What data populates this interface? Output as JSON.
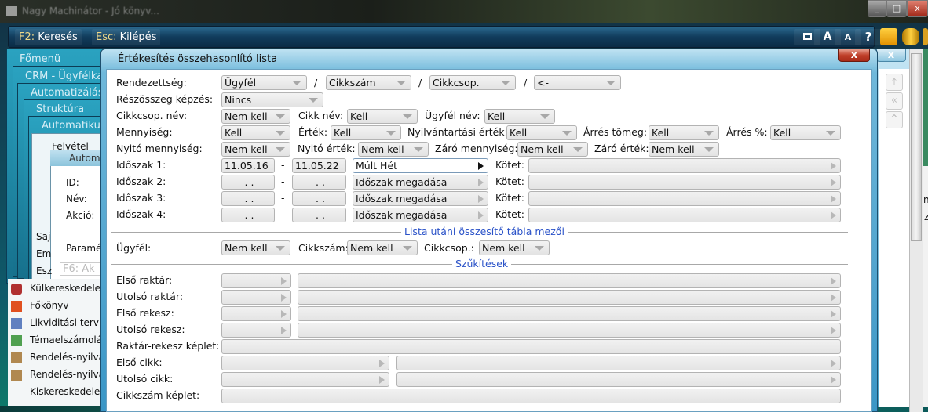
{
  "os_title": "Nagy Machinátor - Jó könyv...",
  "toolbar": {
    "search_key": "F2:",
    "search_label": "Keresés",
    "exit_key": "Esc:",
    "exit_label": "Kilépés",
    "icons": [
      "window-icon",
      "font-large-icon",
      "font-small-icon",
      "help-icon"
    ],
    "help": "?",
    "font_large": "A",
    "font_small": "A"
  },
  "bg": {
    "menu": [
      "Főmenü",
      "CRM - Ügyfélkap",
      "Automatizálás",
      "Struktúra",
      "Automatikus"
    ],
    "felvetel": "Felvétel",
    "autom": "Autom",
    "auto2": "Aut",
    "fields": [
      "ID:",
      "Név:",
      "Akció:"
    ],
    "param": "Paramé",
    "f6": "F6: Ak",
    "side": [
      "Saj",
      "Em",
      "Esz"
    ],
    "list": [
      "Külkereskedelem",
      "Főkönyv",
      "Likviditási terv",
      "Témaelszámolás",
      "Rendelés-nyilvá",
      "Rendelés-nyilvá",
      "Kiskereskedelem"
    ],
    "right": [
      "na",
      "z"
    ]
  },
  "dialog": {
    "title": "Értékesítés összehasonlító lista",
    "close": "x",
    "rend": {
      "label": "Rendezettség:",
      "v": [
        "Ügyfél",
        "Cikkszám",
        "Cikkcsop.",
        "<-"
      ],
      "sep": "/"
    },
    "resz": {
      "label": "Részösszeg képzés:",
      "v": "Nincs"
    },
    "r3": {
      "l1": "Cikkcsop. név:",
      "v1": "Nem kell",
      "l2": "Cikk név:",
      "v2": "Kell",
      "l3": "Ügyfél név:",
      "v3": "Kell"
    },
    "r4": {
      "l1": "Mennyiség:",
      "v1": "Kell",
      "l2": "Érték:",
      "v2": "Kell",
      "l3": "Nyilvántartási érték:",
      "v3": "Kell",
      "l4": "Árrés tömeg:",
      "v4": "Kell",
      "l5": "Árrés %:",
      "v5": "Kell"
    },
    "r5": {
      "l1": "Nyitó mennyiség:",
      "v1": "Nem kell",
      "l2": "Nyitó érték:",
      "v2": "Nem kell",
      "l3": "Záró mennyiség:",
      "v3": "Nem kell",
      "l4": "Záró érték:",
      "v4": "Nem kell"
    },
    "periods": [
      {
        "label": "Időszak 1:",
        "from": "11.05.16",
        "to": "11.05.22",
        "preset": "Múlt Hét",
        "kotet": "Kötet:"
      },
      {
        "label": "Időszak 2:",
        "from": ". .",
        "to": ". .",
        "preset": "Időszak megadása",
        "kotet": "Kötet:"
      },
      {
        "label": "Időszak 3:",
        "from": ". .",
        "to": ". .",
        "preset": "Időszak megadása",
        "kotet": "Kötet:"
      },
      {
        "label": "Időszak 4:",
        "from": ". .",
        "to": ". .",
        "preset": "Időszak megadása",
        "kotet": "Kötet:"
      }
    ],
    "dash": "-",
    "summary_title": "Lista utáni összesítő tábla mezői",
    "summary": {
      "l1": "Ügyfél:",
      "v1": "Nem kell",
      "l2": "Cikkszám:",
      "v2": "Nem kell",
      "l3": "Cikkcsop.:",
      "v3": "Nem kell"
    },
    "filters_title": "Szűkítések",
    "filters": [
      "Első raktár:",
      "Utolsó raktár:",
      "Első rekesz:",
      "Utolsó rekesz:",
      "Raktár-rekesz képlet:",
      "Első cikk:",
      "Utolsó cikk:",
      "Cikkszám képlet:"
    ]
  }
}
